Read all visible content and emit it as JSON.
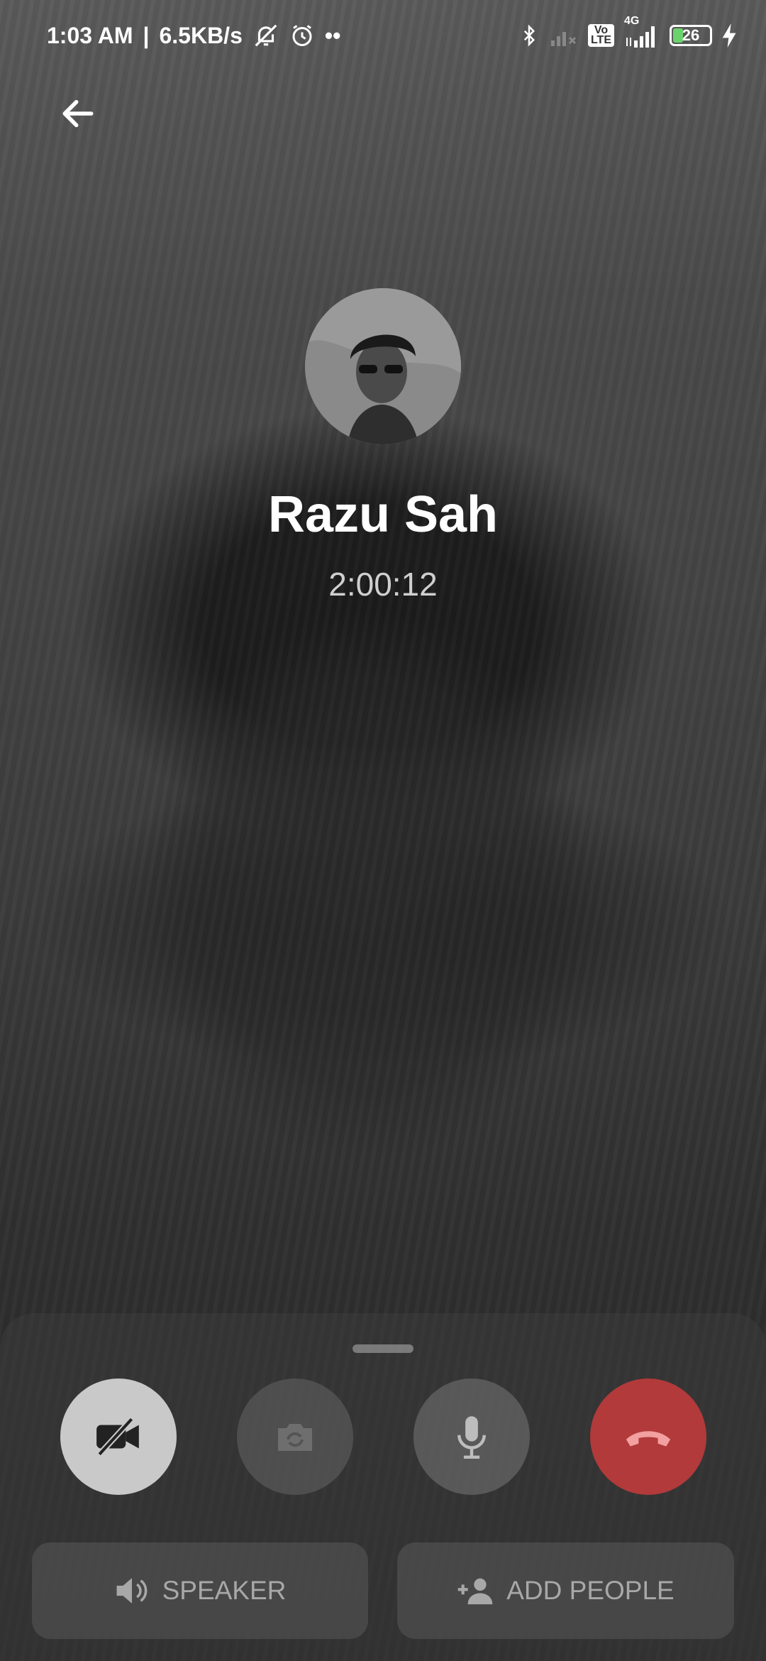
{
  "status_bar": {
    "time": "1:03 AM",
    "speed": "6.5KB/s",
    "separator": "|",
    "dots": "••",
    "volte": "Vo\nLTE",
    "network": "4G",
    "battery": "26"
  },
  "call": {
    "caller_name": "Razu Sah",
    "duration": "2:00:12"
  },
  "controls": {
    "speaker_label": "SPEAKER",
    "add_people_label": "ADD PEOPLE"
  },
  "colors": {
    "end_call": "#b23a3a",
    "battery_fill": "#6bd36b"
  }
}
